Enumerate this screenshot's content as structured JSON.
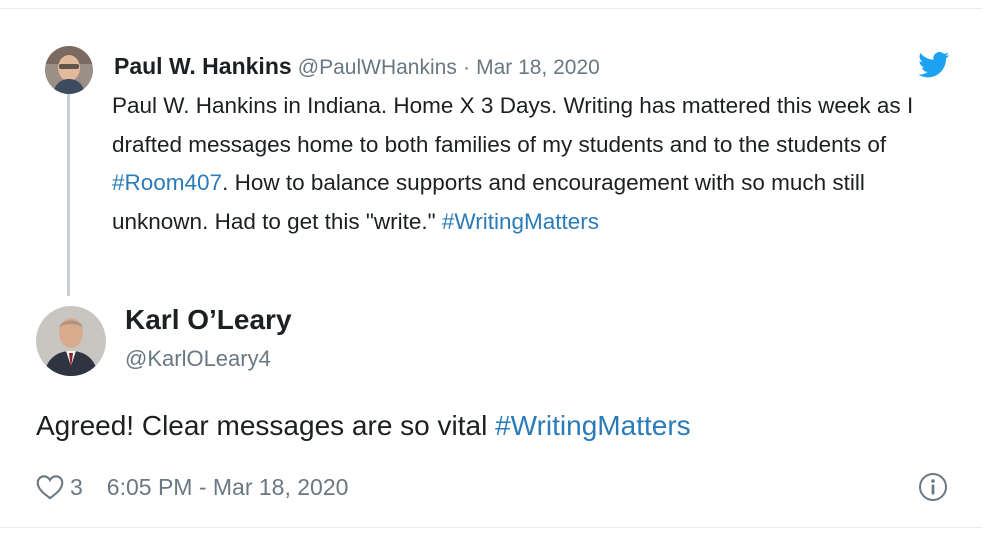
{
  "quoted_tweet": {
    "author_name": "Paul W. Hankins",
    "author_handle": "@PaulWHankins",
    "separator": "·",
    "date": "Mar 18, 2020",
    "text_1": "Paul W. Hankins in Indiana. Home X 3 Days. Writing has mattered this week as I drafted messages home to both families of my students and to the students of ",
    "hashtag_1": "#Room407",
    "text_2": ". How to balance supports and encouragement with so much still unknown. Had to get this \"write.\" ",
    "hashtag_2": "#WritingMatters"
  },
  "reply_tweet": {
    "author_name": "Karl O’Leary",
    "author_handle": "@KarlOLeary4",
    "text": "Agreed! Clear messages are so vital ",
    "hashtag": "#WritingMatters"
  },
  "footer": {
    "like_count": "3",
    "timestamp": "6:05 PM - Mar 18, 2020"
  },
  "colors": {
    "link": "#2b7bb9",
    "twitter_blue": "#1da1f2",
    "muted": "#697882"
  },
  "icons": [
    "twitter-bird-icon",
    "heart-icon",
    "info-icon"
  ]
}
